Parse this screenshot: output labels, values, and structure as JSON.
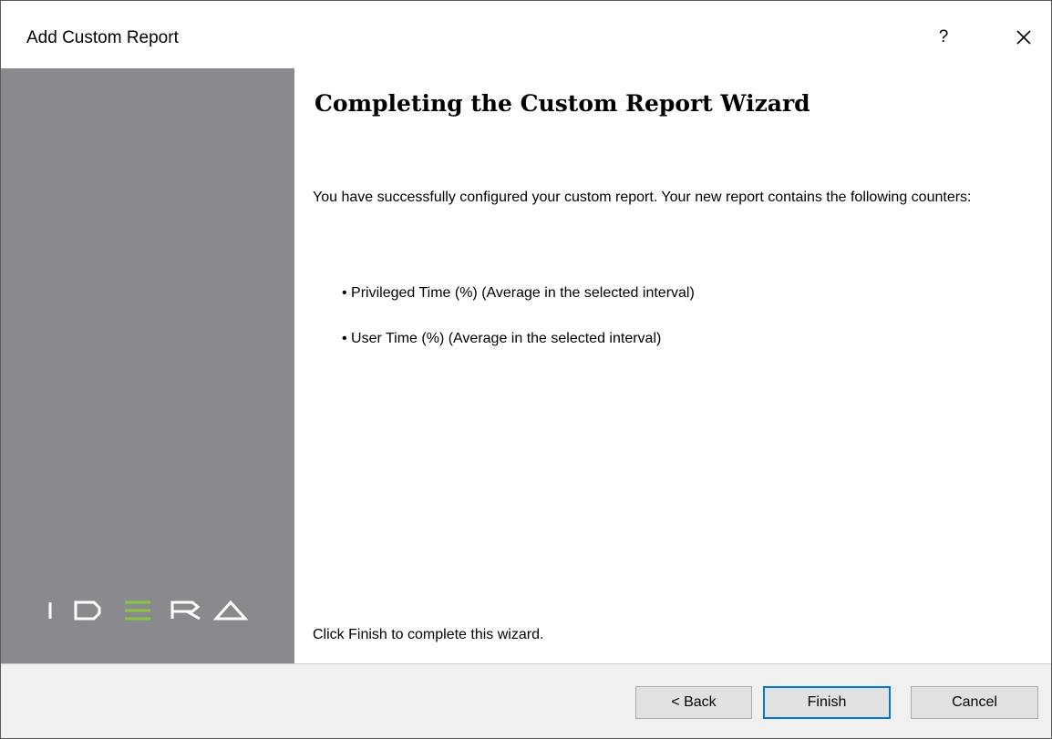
{
  "window": {
    "title": "Add Custom Report",
    "help_label": "?"
  },
  "sidebar": {
    "logo_letters": [
      "I",
      "D",
      "E",
      "R",
      "A"
    ],
    "colors": {
      "background": "#898a8d",
      "logo": "#ffffff",
      "logo_accent": "#8bc53f"
    }
  },
  "main": {
    "heading": "Completing the Custom Report Wizard",
    "intro": "You have successfully configured your custom report. Your new report contains the following counters:",
    "counters": [
      "• Privileged Time (%) (Average in the selected interval)",
      "• User Time (%) (Average in the selected interval)"
    ],
    "finish_note": "Click Finish to complete this wizard."
  },
  "footer": {
    "back_label": "< Back",
    "finish_label": "Finish",
    "cancel_label": "Cancel"
  },
  "colors": {
    "accent": "#0078d7",
    "footer_bg": "#f0f0f0"
  }
}
